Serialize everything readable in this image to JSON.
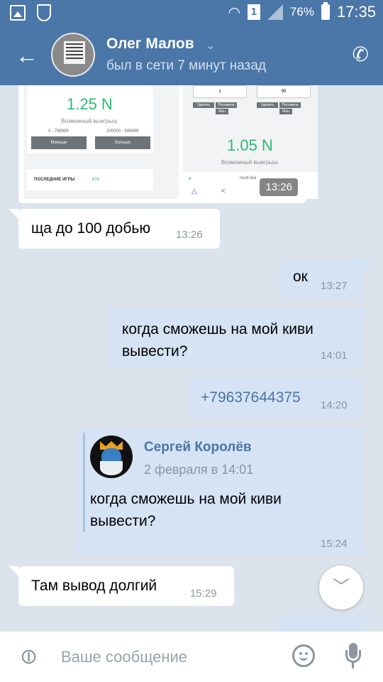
{
  "statusbar": {
    "battery": "76%",
    "time": "17:35",
    "sim": "1"
  },
  "header": {
    "name": "Олег Малов",
    "status": "был в сети 7 минут назад"
  },
  "image_message": {
    "time": "13:26",
    "left": {
      "win_value": "1.25 N",
      "win_label": "Возможный выигрыш",
      "range_low": "0 - 799999",
      "range_high": "200000 - 999999",
      "btn_less": "Меньше",
      "btn_more": "Больше",
      "last_games": "ПОСЛЕДНИЕ ИГРЫ",
      "last_games_count": "678"
    },
    "right": {
      "input_a": "1",
      "input_b": "95",
      "btn_double": "Удвоить",
      "btn_half": "Половина",
      "btn_max": "Макс",
      "btn_min": "Мин",
      "win_value": "1.05 N",
      "win_label": "Возможный выигрыш",
      "url": "nvuti.live"
    }
  },
  "messages": [
    {
      "dir": "in",
      "text": "ща до 100 добью",
      "time": "13:26"
    },
    {
      "dir": "out",
      "text": "ок",
      "time": "13:27"
    },
    {
      "dir": "out",
      "text": "когда сможешь на мой киви вывести?",
      "time": "14:01"
    },
    {
      "dir": "out",
      "text": "+79637644375",
      "time": "14:20"
    },
    {
      "dir": "out",
      "text": "когда сможешь на мой киви вывести?",
      "time": "15:24",
      "forward": {
        "name": "Сергей Королёв",
        "date": "2 февраля в 14:01"
      }
    },
    {
      "dir": "in",
      "text": "Там вывод долгий",
      "time": "15:29"
    }
  ],
  "input": {
    "placeholder": "Ваше сообщение"
  },
  "colors": {
    "header": "#4a76a8",
    "background": "#dbe3ec",
    "outgoing": "#d5e3f4",
    "incoming": "#ffffff",
    "link": "#4b74a3"
  }
}
